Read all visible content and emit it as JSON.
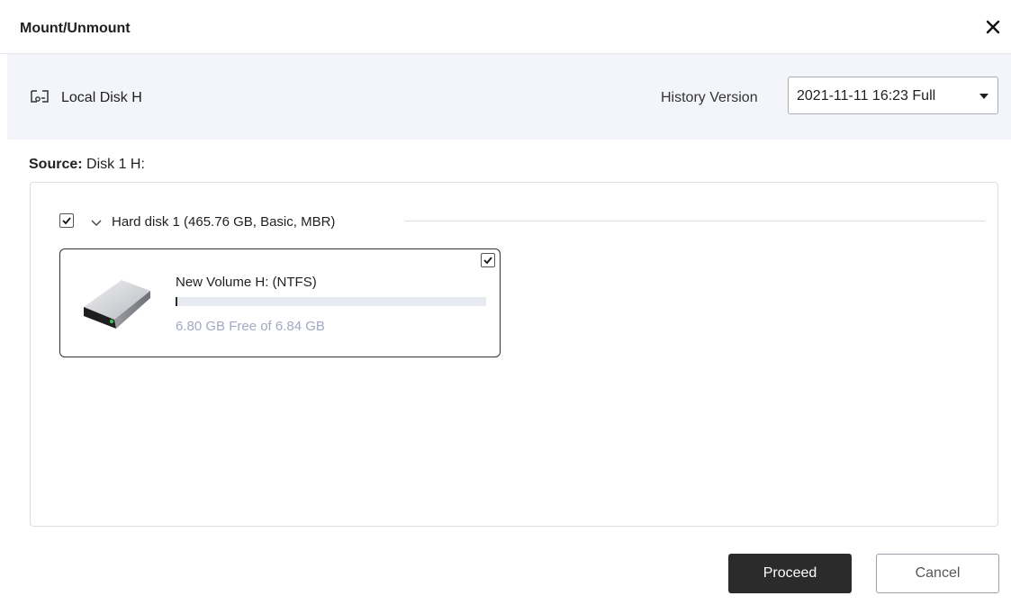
{
  "window": {
    "title": "Mount/Unmount",
    "close_icon": "close-icon"
  },
  "header": {
    "disk_icon": "disk-icon",
    "disk_name": "Local Disk H",
    "history_label": "History Version",
    "history_value": "2021-11-11 16:23 Full"
  },
  "source": {
    "label": "Source:",
    "value": " Disk 1 H:"
  },
  "disk": {
    "checked": true,
    "label": "Hard disk 1 (465.76 GB, Basic, MBR)",
    "volumes": [
      {
        "name": "New Volume H: (NTFS)",
        "checked": true,
        "used_fraction": 0.006,
        "free_text": "6.80 GB Free of 6.84 GB"
      }
    ]
  },
  "buttons": {
    "proceed": "Proceed",
    "cancel": "Cancel"
  },
  "colors": {
    "primary_button": "#2b2b2b",
    "header_band": "#f3f5fa",
    "free_text": "#a3a9c2"
  }
}
